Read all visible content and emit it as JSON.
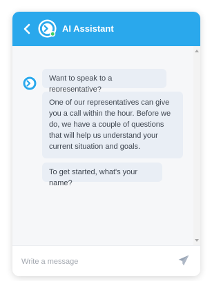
{
  "header": {
    "title": "AI Assistant",
    "back_icon": "chevron-left-icon",
    "logo_icon": "assistant-logo-icon",
    "background_color": "#2aa8ec"
  },
  "messages": [
    {
      "sender": "bot",
      "text": "Want to speak to a representative?"
    },
    {
      "sender": "bot",
      "text": "One of our representatives can give you a call within the hour. Before we do, we have a couple of questions that will help us understand your current situation and goals."
    },
    {
      "sender": "bot",
      "text": "To get started, what's your name?"
    }
  ],
  "composer": {
    "placeholder": "Write a message",
    "value": "",
    "send_icon": "send-icon"
  }
}
